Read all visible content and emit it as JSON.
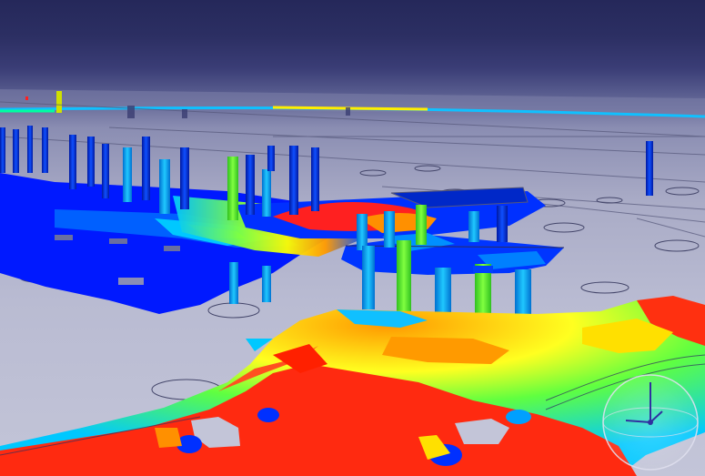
{
  "viewer": {
    "colors": {
      "sky_top": "#25285a",
      "floor": "#b9bbd2",
      "heat_high": "#ff0000",
      "heat_mid_high": "#ff9900",
      "heat_mid": "#ffff00",
      "heat_mid_low": "#33ff33",
      "heat_low_mid": "#00c8ff",
      "heat_low": "#0033ff"
    },
    "nav_gizmo_icon": "orbit-navigation-icon"
  }
}
